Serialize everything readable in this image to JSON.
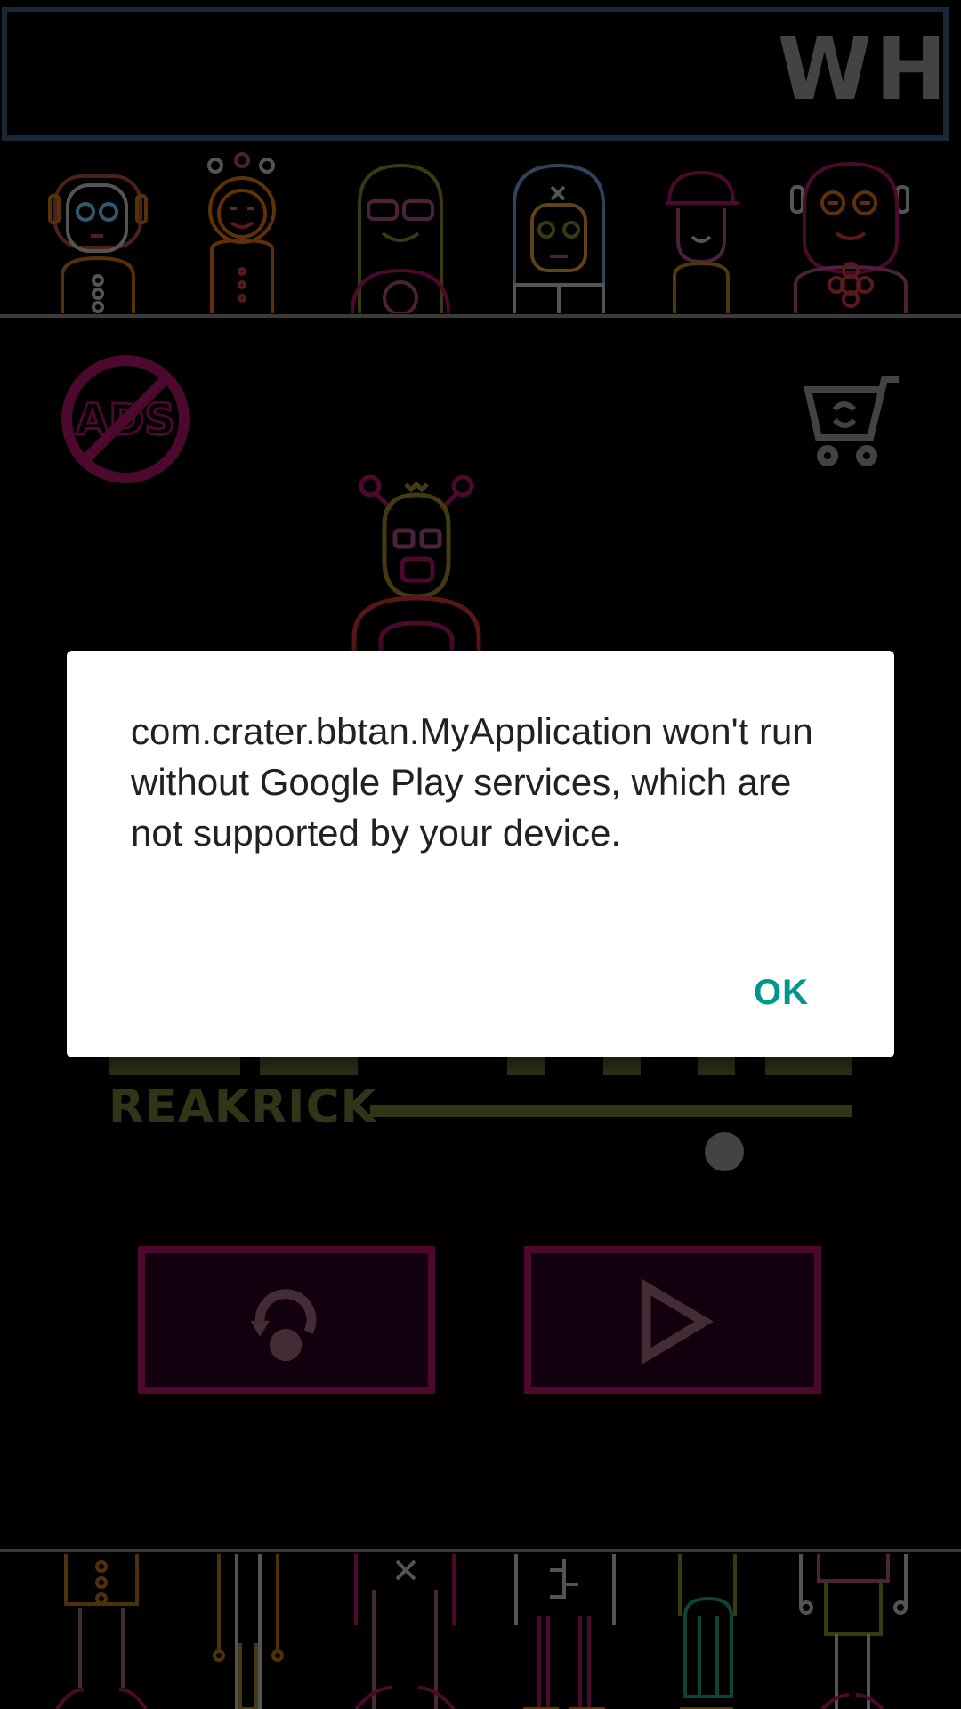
{
  "banner": {
    "text": "WH"
  },
  "title": {
    "subtitle": "REAKRICK"
  },
  "no_ads": {
    "label": "ADS"
  },
  "dialog": {
    "message": "com.crater.bbtan.MyApplication won't run without Google Play services, which are not supported by your device.",
    "ok_label": "OK"
  },
  "colors": {
    "dialog_button": "#00968a",
    "button_border": "#8a0f52",
    "button_fill": "#22001a",
    "title_olive": "#5d5f2a",
    "banner_border": "#2c4a63"
  },
  "icons": [
    "no-ads-icon",
    "cart-refresh-icon",
    "restart-icon",
    "play-icon"
  ]
}
